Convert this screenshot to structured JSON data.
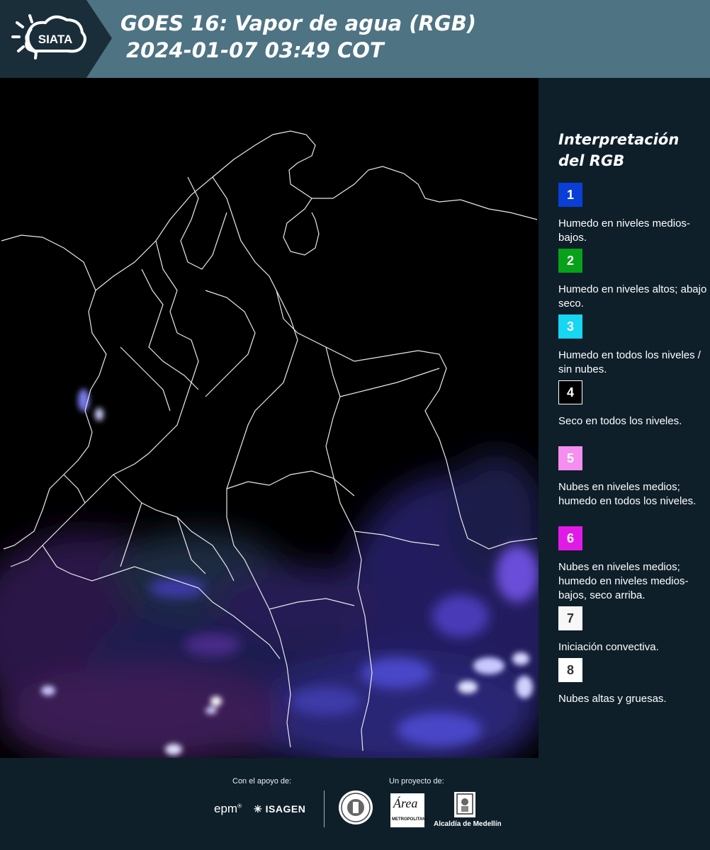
{
  "header": {
    "logo_text": "SIATA",
    "title_line1": "GOES 16: Vapor de agua (RGB)",
    "title_line2": "2024-01-07 03:49 COT"
  },
  "legend": {
    "title": "Interpretación del RGB",
    "items": [
      {
        "number": "1",
        "color": "#0a3fd6",
        "text_color": "#ffffff",
        "label": "Humedo en niveles medios-bajos."
      },
      {
        "number": "2",
        "color": "#07a21a",
        "text_color": "#ffffff",
        "label": "Humedo en niveles altos; abajo seco."
      },
      {
        "number": "3",
        "color": "#16d6f2",
        "text_color": "#ffffff",
        "label": "Humedo en todos los niveles / sin nubes."
      },
      {
        "number": "4",
        "color": "#000000",
        "text_color": "#ffffff",
        "label": "Seco en todos los niveles."
      },
      {
        "number": "5",
        "color": "#f58ef0",
        "text_color": "#ffffff",
        "label": "Nubes en niveles medios; humedo en todos los niveles."
      },
      {
        "number": "6",
        "color": "#e21ae8",
        "text_color": "#ffffff",
        "label": "Nubes en niveles medios; humedo en niveles medios-bajos, seco arriba."
      },
      {
        "number": "7",
        "color": "#f7f7f7",
        "text_color": "#333333",
        "label": "Iniciación convectiva."
      },
      {
        "number": "8",
        "color": "#ffffff",
        "text_color": "#333333",
        "label": "Nubes altas y gruesas."
      }
    ]
  },
  "footer": {
    "support_label": "Con el apoyo de:",
    "project_label": "Un proyecto de:",
    "epm": "epm",
    "isagen": "ISAGEN",
    "area_name": "Área",
    "area_sub": "METROPOLITANA",
    "alcaldia": "Alcaldía de Medellín"
  }
}
